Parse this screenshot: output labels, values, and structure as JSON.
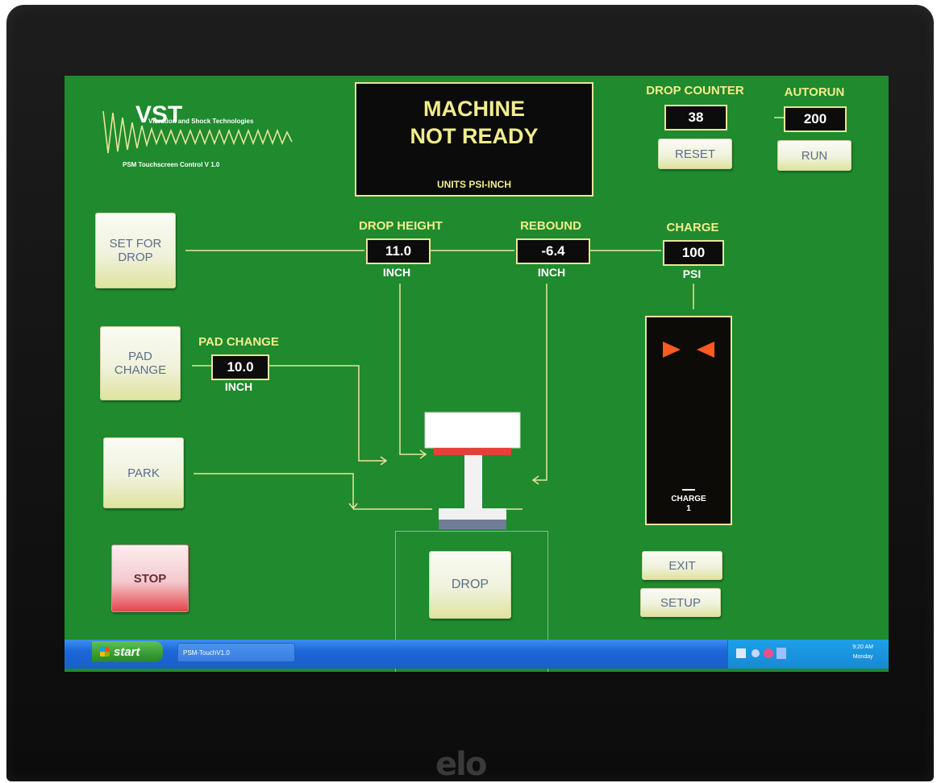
{
  "logo": {
    "company": "Vibration and Shock Technologies",
    "version": "PSM Touchscreen Control V 1.0"
  },
  "status": {
    "line1": "MACHINE",
    "line2": "NOT READY",
    "units": "UNITS PSI-INCH"
  },
  "drop_counter": {
    "label": "DROP COUNTER",
    "value": "38",
    "reset_label": "RESET"
  },
  "autorun": {
    "label": "AUTORUN",
    "value": "200",
    "run_label": "RUN"
  },
  "drop_height": {
    "label": "DROP HEIGHT",
    "value": "11.0",
    "unit": "INCH"
  },
  "rebound": {
    "label": "REBOUND",
    "value": "-6.4",
    "unit": "INCH"
  },
  "charge": {
    "label": "CHARGE",
    "value": "100",
    "unit": "PSI",
    "gauge_label": "CHARGE",
    "gauge_value": "1"
  },
  "pad_change": {
    "label": "PAD CHANGE",
    "value": "10.0",
    "unit": "INCH"
  },
  "buttons": {
    "set_for_drop": [
      "SET FOR",
      "DROP"
    ],
    "pad_change": [
      "PAD",
      "CHANGE"
    ],
    "park": "PARK",
    "stop": "STOP",
    "drop": "DROP",
    "exit": "EXIT",
    "setup": "SETUP"
  },
  "taskbar": {
    "start": "start",
    "task": "PSM-TouchV1.0",
    "time": "9:20 AM",
    "day": "Monday"
  },
  "colors": {
    "screen_bg": "#1f8a2e",
    "label": "#f2ed8c",
    "value_bg": "#0c0c0c",
    "stop_red": "#e4454b",
    "gauge_marker": "#ff5a1f"
  },
  "monitor": {
    "brand": "elo"
  }
}
